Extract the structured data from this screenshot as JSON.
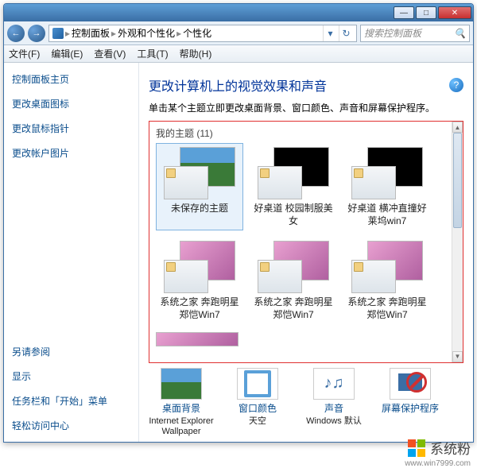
{
  "titlebar": {
    "minimize": "—",
    "maximize": "□",
    "close": "✕"
  },
  "nav": {
    "back": "←",
    "forward": "→",
    "breadcrumb": [
      "控制面板",
      "外观和个性化",
      "个性化"
    ],
    "sep": "▸",
    "dropdown": "▾",
    "refresh": "↻"
  },
  "search": {
    "placeholder": "搜索控制面板",
    "icon": "🔍"
  },
  "menu": {
    "file": "文件(F)",
    "edit": "编辑(E)",
    "view": "查看(V)",
    "tools": "工具(T)",
    "help": "帮助(H)"
  },
  "sidebar": {
    "home": "控制面板主页",
    "links": [
      "更改桌面图标",
      "更改鼠标指针",
      "更改帐户图片"
    ],
    "see_also_title": "另请参阅",
    "see_also": [
      "显示",
      "任务栏和「开始」菜单",
      "轻松访问中心"
    ]
  },
  "page": {
    "title": "更改计算机上的视觉效果和声音",
    "subtitle": "单击某个主题立即更改桌面背景、窗口颜色、声音和屏幕保护程序。",
    "help": "?"
  },
  "themes": {
    "section": "我的主题 (11)",
    "items": [
      {
        "label": "未保存的主题",
        "variant": "landscape",
        "selected": true
      },
      {
        "label": "好桌道 校园制服美女",
        "variant": "black",
        "selected": false
      },
      {
        "label": "好桌道 横冲直撞好莱坞win7",
        "variant": "black",
        "selected": false
      },
      {
        "label": "系统之家 奔跑明星郑恺Win7",
        "variant": "pink",
        "selected": false
      },
      {
        "label": "系统之家 奔跑明星郑恺Win7",
        "variant": "pink",
        "selected": false
      },
      {
        "label": "系统之家 奔跑明星郑恺Win7",
        "variant": "pink",
        "selected": false
      }
    ]
  },
  "bottom": {
    "items": [
      {
        "label": "桌面背景",
        "sub": "Internet Explorer Wallpaper"
      },
      {
        "label": "窗口颜色",
        "sub": "天空"
      },
      {
        "label": "声音",
        "sub": "Windows 默认"
      },
      {
        "label": "屏幕保护程序",
        "sub": ""
      }
    ]
  },
  "watermark": {
    "text": "系统粉",
    "url": "www.win7999.com"
  }
}
